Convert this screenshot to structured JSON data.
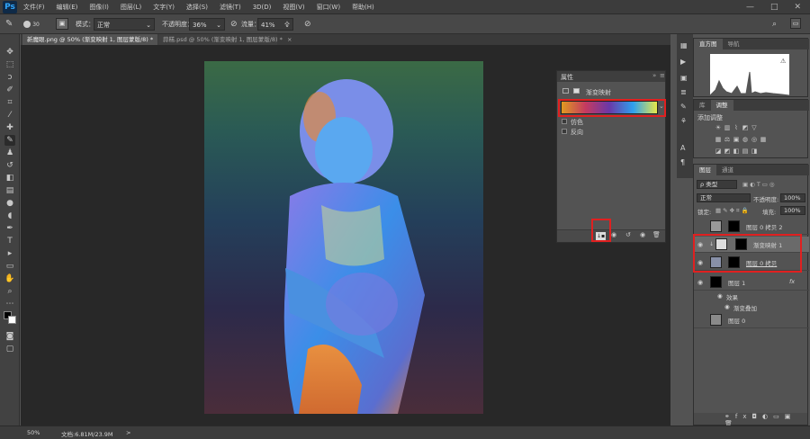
{
  "app": {
    "logo": "Ps"
  },
  "menu": [
    "文件(F)",
    "编辑(E)",
    "图像(I)",
    "图层(L)",
    "文字(Y)",
    "选择(S)",
    "滤镜(T)",
    "3D(D)",
    "视图(V)",
    "窗口(W)",
    "帮助(H)"
  ],
  "window_controls": {
    "min": "—",
    "max": "□",
    "close": "✕"
  },
  "options": {
    "brush_size": "30",
    "mode_label": "模式：",
    "mode_value": "正常",
    "opacity_label": "不透明度：",
    "opacity_value": "36%",
    "flow_label": "流量：",
    "flow_value": "41%"
  },
  "tabs": [
    {
      "label": "新魔眼.png @ 50% (渐变映射 1, 图层蒙版/8) *",
      "close": "×"
    },
    {
      "label": "蒜糕.psd @ 50% (渐变映射 1, 图层蒙版/8) *",
      "close": "×"
    }
  ],
  "properties": {
    "title": "属性",
    "subtitle": "渐变映射",
    "dither_label": "仿色",
    "reverse_label": "反向"
  },
  "histogram": {
    "tabs": [
      "直方图",
      "导航"
    ]
  },
  "adjustments": {
    "tabs": [
      "库",
      "调整"
    ],
    "add_label": "添加调整"
  },
  "layers_panel": {
    "tabs": [
      "图层",
      "通道"
    ],
    "filter_kind": "ρ 类型",
    "blend_mode": "正常",
    "opacity_label": "不透明度:",
    "opacity_value": "100%",
    "lock_label": "锁定:",
    "fill_label": "填充:",
    "fill_value": "100%",
    "layers": [
      {
        "name": "图层 0 拷贝 2"
      },
      {
        "name": "渐变映射 1"
      },
      {
        "name": "图层 0 拷贝"
      },
      {
        "name": "图层 1",
        "fx": "fx"
      },
      {
        "name": "效果"
      },
      {
        "name": "渐变叠加"
      },
      {
        "name": "图层 0"
      }
    ]
  },
  "status": {
    "zoom": "50%",
    "doc": "文档:6.81M/23.9M",
    "arrow": ">"
  },
  "colors": {
    "accent": "#e02020",
    "panel": "#535353",
    "canvas_bg": "#282828"
  }
}
